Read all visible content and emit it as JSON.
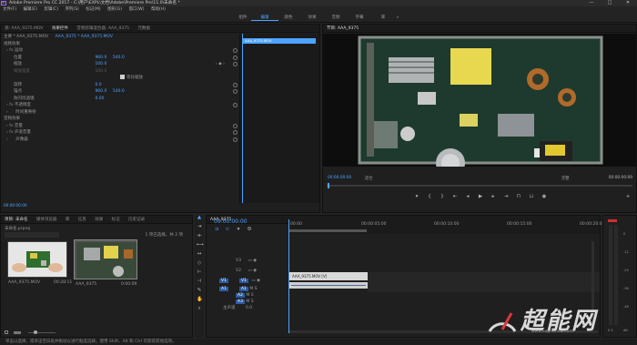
{
  "window": {
    "title": "Adobe Premiere Pro CC 2017 - C:\\用户\\EXPL\\文档\\Adobe\\Premiere Pro\\11.0\\未命名 *",
    "min": "—",
    "max": "□",
    "close": "✕",
    "app_icon": "Pr"
  },
  "menu": [
    "文件(F)",
    "编辑(E)",
    "剪辑(C)",
    "序列(S)",
    "标记(M)",
    "图形(G)",
    "窗口(W)",
    "帮助(H)"
  ],
  "workspaces": {
    "items": [
      "组件",
      "编辑",
      "颜色",
      "效果",
      "音频",
      "字幕",
      "库"
    ],
    "active_index": 1,
    "more": "»"
  },
  "effect_controls": {
    "tabs": [
      "源: AAA_9375.MOV",
      "效果控件",
      "音频剪辑混合器: AAA_9375",
      "元数据"
    ],
    "active_tab": 1,
    "source_label": "主要 * AAA_9375.MOV",
    "seq_label": "AAA_9375 * AAA_9375.MOV",
    "sections": {
      "video": "视频效果",
      "audio": "音频效果"
    },
    "motion": "运动",
    "position": {
      "label": "位置",
      "x": "960.0",
      "y": "540.0"
    },
    "scale": {
      "label": "缩放",
      "value": "100.0"
    },
    "scale_width": {
      "label": "缩放宽度",
      "value": "100.0"
    },
    "uniform_scale": "等比缩放",
    "rotation": {
      "label": "旋转",
      "value": "0.0"
    },
    "anchor": {
      "label": "锚点",
      "x": "960.0",
      "y": "540.0"
    },
    "anti_flicker": {
      "label": "防闪烁滤镜",
      "value": "0.00"
    },
    "opacity": "不透明度",
    "time_remap": "时间重映射",
    "volume": "音量",
    "channel_volume": "声道音量",
    "panner": "声像器",
    "mini_clip": "AAA_9375.MOV",
    "timecode": "00:00:00:00"
  },
  "program": {
    "title": "节目: AAA_9375",
    "timecode": "00:00:00:00",
    "fit": "适合",
    "res": "完整",
    "duration": "00:00:00:09",
    "controls": [
      "marker-icon",
      "in-icon",
      "out-icon",
      "goto-in-icon",
      "step-back-icon",
      "play-icon",
      "step-forward-icon",
      "goto-out-icon",
      "lift-icon",
      "extract-icon",
      "export-frame-icon"
    ]
  },
  "project": {
    "tabs": [
      "项目: 未命名",
      "媒体浏览器",
      "库",
      "信息",
      "效果",
      "标记",
      "历史记录"
    ],
    "active_tab": 0,
    "file": "未命名.prproj",
    "count": "1 项已选择，共 2 项",
    "items": [
      {
        "name": "AAA_9375.MOV",
        "dur": "00:28:11"
      },
      {
        "name": "AAA_9375",
        "dur": "0:00:09"
      }
    ]
  },
  "timeline": {
    "tab": "AAA_9375",
    "timecode": "00:00:00:00",
    "ruler": [
      "00:00",
      "00:00:05:00",
      "00:00:10:00",
      "00:00:15:00",
      "00:00:20:00"
    ],
    "video_tracks": [
      "V3",
      "V2",
      "V1"
    ],
    "audio_tracks": [
      "A1",
      "A2",
      "A3"
    ],
    "master": "主声道",
    "master_val": "0.0",
    "clip_video": "AAA_9375.MOV [V]",
    "meter_labels": [
      "0",
      "-12",
      "-24",
      "-36",
      "-48",
      "dB"
    ]
  },
  "status": "单击以选择，或单击空白处并拖动以进行框选选择。使用 Shift、Alt 和 Ctrl 可获得其他选项。",
  "watermark": {
    "text": "超能网",
    "url": "www.expreview.com"
  },
  "colors": {
    "accent": "#4ea3ff",
    "clip_audio": "#cfcfcf"
  }
}
